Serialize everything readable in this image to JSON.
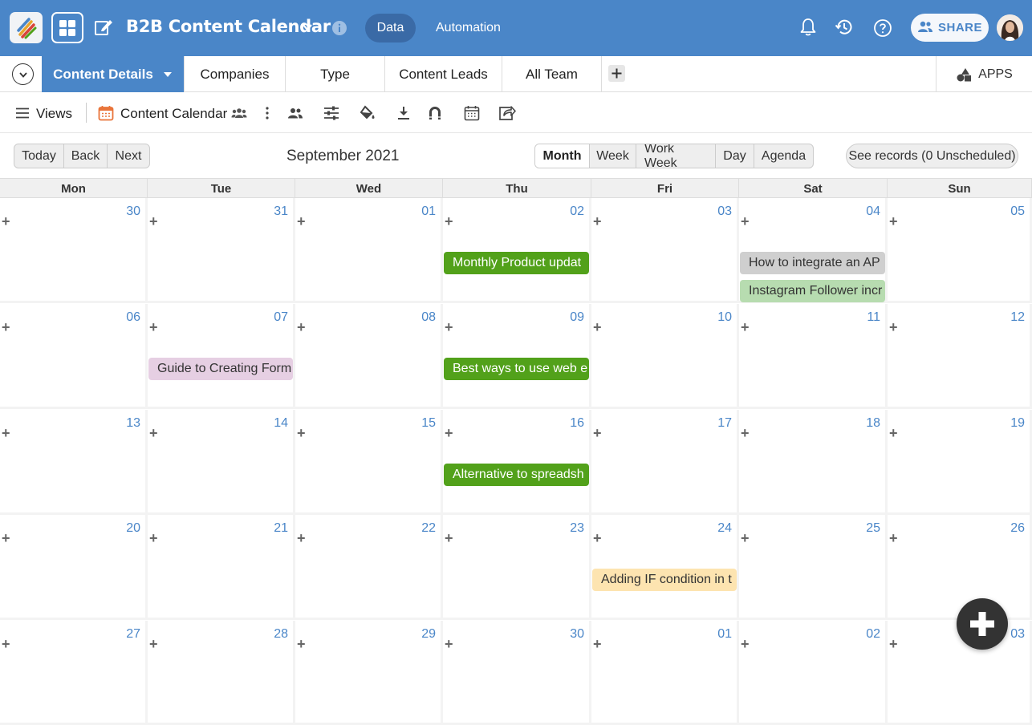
{
  "header": {
    "title": "B2B Content Calendar",
    "data_label": "Data",
    "automation_label": "Automation",
    "share_label": "SHARE"
  },
  "tabs": [
    {
      "label": "Content Details",
      "active": true
    },
    {
      "label": "Companies"
    },
    {
      "label": "Type"
    },
    {
      "label": "Content Leads"
    },
    {
      "label": "All Team"
    }
  ],
  "apps_label": "APPS",
  "toolbar": {
    "views_label": "Views",
    "calendar_view_label": "Content Calendar"
  },
  "calendar": {
    "nav": {
      "today": "Today",
      "back": "Back",
      "next": "Next"
    },
    "title": "September 2021",
    "views": [
      "Month",
      "Week",
      "Work Week",
      "Day",
      "Agenda"
    ],
    "selected_view": "Month",
    "see_records": "See records (0 Unscheduled)",
    "weekdays": [
      "Mon",
      "Tue",
      "Wed",
      "Thu",
      "Fri",
      "Sat",
      "Sun"
    ],
    "weeks": [
      [
        "30",
        "31",
        "01",
        "02",
        "03",
        "04",
        "05"
      ],
      [
        "06",
        "07",
        "08",
        "09",
        "10",
        "11",
        "12"
      ],
      [
        "13",
        "14",
        "15",
        "16",
        "17",
        "18",
        "19"
      ],
      [
        "20",
        "21",
        "22",
        "23",
        "24",
        "25",
        "26"
      ],
      [
        "27",
        "28",
        "29",
        "30",
        "01",
        "02",
        "03"
      ]
    ],
    "events": [
      {
        "week": 0,
        "day": 3,
        "slot": 0,
        "title": "Monthly Product updat",
        "color": "#52a11a",
        "text_color": "#ffffff"
      },
      {
        "week": 0,
        "day": 5,
        "slot": 0,
        "title": "How to integrate an AP",
        "color": "#cfcfcf",
        "text_color": "#333333"
      },
      {
        "week": 0,
        "day": 5,
        "slot": 1,
        "title": "Instagram Follower incr",
        "color": "#b7dcb0",
        "text_color": "#333333"
      },
      {
        "week": 1,
        "day": 1,
        "slot": 0,
        "title": "Guide to Creating Form",
        "color": "#e6cfe3",
        "text_color": "#333333"
      },
      {
        "week": 1,
        "day": 3,
        "slot": 0,
        "title": "Best ways to use web e",
        "color": "#52a11a",
        "text_color": "#ffffff"
      },
      {
        "week": 2,
        "day": 3,
        "slot": 0,
        "title": "Alternative to spreadsh",
        "color": "#52a11a",
        "text_color": "#ffffff"
      },
      {
        "week": 3,
        "day": 4,
        "slot": 0,
        "title": "Adding IF condition in t",
        "color": "#fde4b0",
        "text_color": "#333333"
      }
    ]
  },
  "colors": {
    "brand": "#4a86c8",
    "accent_dark": "#3a6aa6"
  },
  "icons": [
    "app-logo-icon",
    "grid-icon",
    "edit-icon",
    "chevron-down-icon",
    "info-icon",
    "bell-icon",
    "history-icon",
    "help-icon",
    "share-people-icon",
    "collapse-chevron-icon",
    "plus-icon",
    "apps-shapes-icon",
    "hamburger-icon",
    "calendar-icon",
    "team-icon",
    "more-vertical-icon",
    "people-icon",
    "filter-sliders-icon",
    "paint-bucket-icon",
    "download-icon",
    "magnet-icon",
    "calendar-grid-icon",
    "share-arrow-icon",
    "fab-plus-icon"
  ]
}
